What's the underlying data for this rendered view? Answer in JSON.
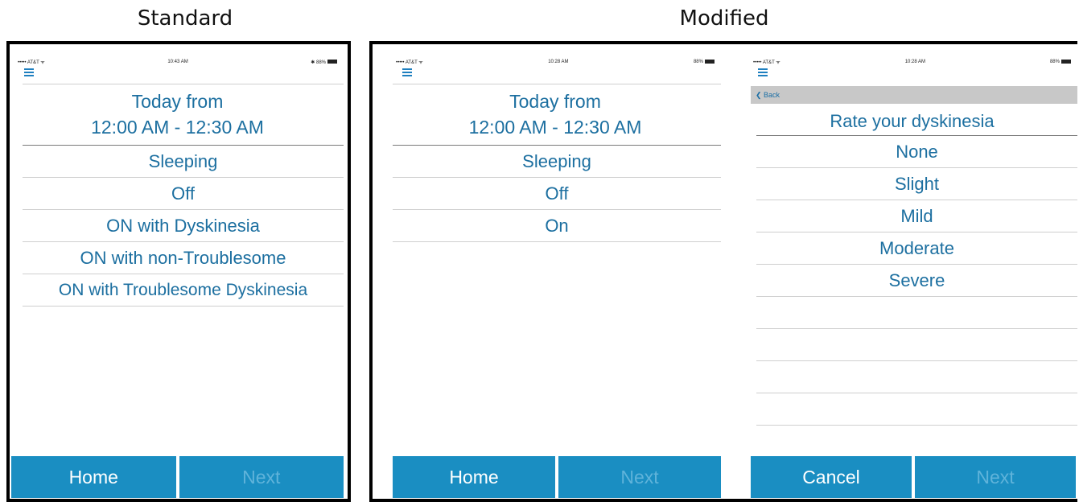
{
  "captions": {
    "standard": "Standard",
    "modified": "Modified"
  },
  "status": {
    "carrier": "••••• AT&T ᯤ",
    "time_a": "10:43 AM",
    "time_b": "10:28 AM",
    "battery_a": "✱ 88%",
    "battery_b": "88%"
  },
  "screen_a": {
    "header_line1": "Today from",
    "header_line2": "12:00 AM  -  12:30 AM",
    "options": [
      "Sleeping",
      "Off",
      "ON with Dyskinesia",
      "ON with non-Troublesome",
      "ON with Troublesome Dyskinesia"
    ],
    "home_label": "Home",
    "next_label": "Next"
  },
  "screen_b": {
    "header_line1": "Today from",
    "header_line2": "12:00 AM  -  12:30 AM",
    "options": [
      "Sleeping",
      "Off",
      "On"
    ],
    "home_label": "Home",
    "next_label": "Next"
  },
  "screen_c": {
    "back_label": "❮ Back",
    "title": "Rate your dyskinesia",
    "options": [
      "None",
      "Slight",
      "Mild",
      "Moderate",
      "Severe"
    ],
    "cancel_label": "Cancel",
    "next_label": "Next"
  },
  "colors": {
    "accent": "#1a8ec2",
    "text_blue": "#1c6fa0"
  },
  "icons": {
    "menu": "hamburger-menu-icon",
    "back": "chevron-left-icon"
  }
}
